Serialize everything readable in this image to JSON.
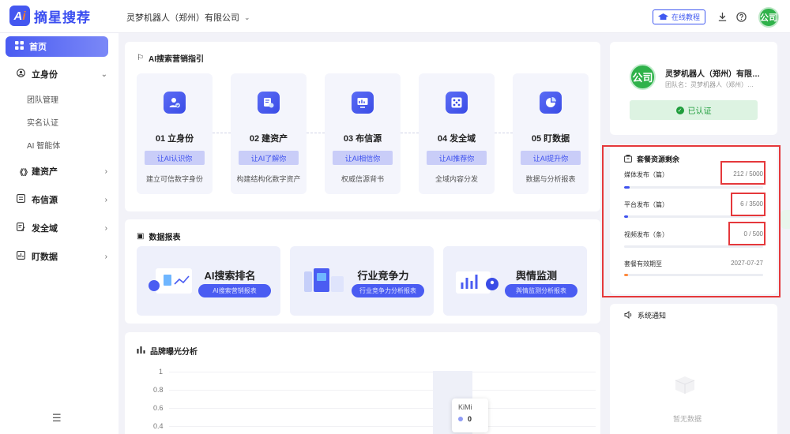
{
  "app": {
    "logo_text": "摘星搜荐",
    "logo_mark": "Ai"
  },
  "header": {
    "company": "灵梦机器人（郑州）有限公司",
    "tutorial_label": "在线教程",
    "avatar_text": "公司"
  },
  "sidebar": {
    "home": "首页",
    "items": [
      {
        "label": "立身份",
        "icon": "identity-icon",
        "expanded": true
      },
      {
        "label": "建资产",
        "icon": "asset-icon"
      },
      {
        "label": "布信源",
        "icon": "source-icon"
      },
      {
        "label": "发全域",
        "icon": "publish-icon"
      },
      {
        "label": "盯数据",
        "icon": "data-icon"
      }
    ],
    "sub_items": [
      "团队管理",
      "实名认证",
      "AI 智能体"
    ]
  },
  "guide": {
    "title": "AI搜索营销指引",
    "steps": [
      {
        "title": "01 立身份",
        "button": "让AI认识你",
        "desc": "建立可信数字身份",
        "icon": "user-check-icon"
      },
      {
        "title": "02 建资产",
        "button": "让AI了解你",
        "desc": "构建结构化数字资产",
        "icon": "asset-settings-icon"
      },
      {
        "title": "03 布信源",
        "button": "让AI相信你",
        "desc": "权威信源背书",
        "icon": "monitor-chart-icon"
      },
      {
        "title": "04 发全域",
        "button": "让AI推荐你",
        "desc": "全域内容分发",
        "icon": "network-icon"
      },
      {
        "title": "05 盯数据",
        "button": "让AI提升你",
        "desc": "数据与分析报表",
        "icon": "pie-chart-icon"
      }
    ]
  },
  "reports": {
    "title": "数据报表",
    "items": [
      {
        "title": "AI搜索排名",
        "button": "AI搜索营销报表"
      },
      {
        "title": "行业竞争力",
        "button": "行业竞争力分析报表"
      },
      {
        "title": "舆情监测",
        "button": "舆情监测分析报表"
      }
    ]
  },
  "brand_chart": {
    "title": "品牌曝光分析",
    "y_ticks": [
      "1",
      "0.8",
      "0.6",
      "0.4"
    ],
    "tooltip_series": "KiMi",
    "tooltip_value": "0"
  },
  "profile": {
    "avatar_text": "公司",
    "name": "灵梦机器人（郑州）有限…",
    "team": "团队名：灵梦机器人（郑州）…",
    "verified_label": "已认证"
  },
  "quota": {
    "title": "套餐资源剩余",
    "items": [
      {
        "label": "媒体发布（篇）",
        "value": "212 / 5000",
        "fill": 0.042
      },
      {
        "label": "平台发布（篇）",
        "value": "6 / 3500",
        "fill": 0.002
      },
      {
        "label": "视频发布（条）",
        "value": "0 / 500",
        "fill": 0
      },
      {
        "label": "套餐有效期至",
        "value": "2027-07-27",
        "fill": 0.02
      }
    ]
  },
  "notifications": {
    "title": "系统通知",
    "empty_text": "暂无数据"
  },
  "colors": {
    "accent": "#3f52ee",
    "success": "#1f9d3c",
    "highlight_box": "#e5383b"
  }
}
